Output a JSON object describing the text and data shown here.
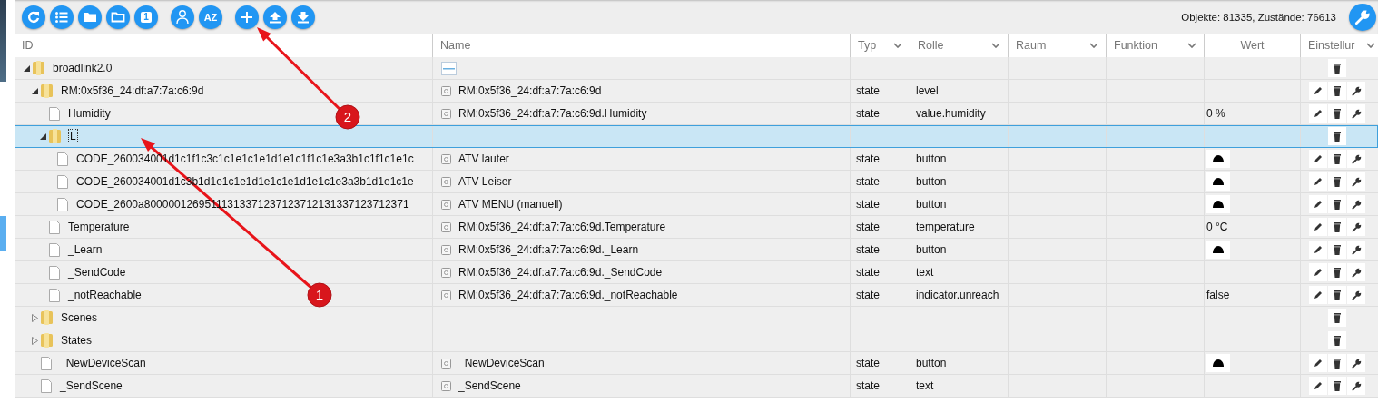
{
  "toolbar": {
    "groups": [
      [
        {
          "kind": "refresh"
        },
        {
          "kind": "list"
        },
        {
          "kind": "folder"
        },
        {
          "kind": "folder-outline"
        },
        {
          "kind": "page",
          "label": "1"
        }
      ],
      [
        {
          "kind": "user"
        },
        {
          "kind": "sort",
          "label": "AZ"
        }
      ],
      [
        {
          "kind": "add"
        },
        {
          "kind": "upload"
        },
        {
          "kind": "download"
        }
      ]
    ],
    "status": "Objekte: 81335, Zustände: 76613",
    "settings_button": {
      "kind": "wrench"
    }
  },
  "table": {
    "columns": [
      {
        "label": "ID",
        "menu": false
      },
      {
        "label": "Name",
        "menu": false
      },
      {
        "label": "Typ",
        "menu": true
      },
      {
        "label": "Rolle",
        "menu": true
      },
      {
        "label": "Raum",
        "menu": true
      },
      {
        "label": "Funktion",
        "menu": true
      },
      {
        "label": "Wert",
        "menu": false
      },
      {
        "label": "Einstellur",
        "menu": true
      }
    ],
    "rows": [
      {
        "id": "broadlink2.0",
        "kind": "folder",
        "expanded": true,
        "selected": false,
        "name_icon": {
          "kind": "logo"
        },
        "editable": false,
        "children": [
          {
            "id": "RM:0x5f36_24:df:a7:7a:c6:9d",
            "kind": "folder",
            "expanded": true,
            "selected": false,
            "name_icon": {
              "kind": "state"
            },
            "name": "RM:0x5f36_24:df:a7:7a:c6:9d",
            "typ": "state",
            "role": "level",
            "editable": true,
            "children": [
              {
                "id": "Humidity",
                "kind": "file",
                "selected": false,
                "name_icon": {
                  "kind": "state"
                },
                "name": "RM:0x5f36_24:df:a7:7a:c6:9d.Humidity",
                "typ": "state",
                "role": "value.humidity",
                "value": "0 %",
                "editable": true
              },
              {
                "id": "L",
                "kind": "folder",
                "expanded": true,
                "selected": true,
                "editable": false,
                "children": [
                  {
                    "id": "CODE_260034001d1c1f1c3c1c1e1c1e1d1e1c1f1c1e3a3b1c1f1c1e1c",
                    "kind": "file",
                    "selected": false,
                    "name_icon": {
                      "kind": "state"
                    },
                    "name": "ATV lauter",
                    "typ": "state",
                    "role": "button",
                    "value_icon": {
                      "kind": "bell"
                    },
                    "editable": true
                  },
                  {
                    "id": "CODE_260034001d1c3b1d1e1c1e1d1e1c1e1d1e1c1e3a3b1d1e1c1e",
                    "kind": "file",
                    "selected": false,
                    "name_icon": {
                      "kind": "state"
                    },
                    "name": "ATV Leiser",
                    "typ": "state",
                    "role": "button",
                    "value_icon": {
                      "kind": "bell"
                    },
                    "editable": true
                  },
                  {
                    "id": "CODE_2600a80000012695111313371237123712131337123712371",
                    "kind": "file",
                    "selected": false,
                    "name_icon": {
                      "kind": "state"
                    },
                    "name": "ATV MENU (manuell)",
                    "typ": "state",
                    "role": "button",
                    "value_icon": {
                      "kind": "bell"
                    },
                    "editable": true
                  }
                ]
              },
              {
                "id": "Temperature",
                "kind": "file",
                "selected": false,
                "name_icon": {
                  "kind": "state"
                },
                "name": "RM:0x5f36_24:df:a7:7a:c6:9d.Temperature",
                "typ": "state",
                "role": "temperature",
                "value": "0 °C",
                "editable": true
              },
              {
                "id": "_Learn",
                "kind": "file",
                "selected": false,
                "name_icon": {
                  "kind": "state"
                },
                "name": "RM:0x5f36_24:df:a7:7a:c6:9d._Learn",
                "typ": "state",
                "role": "button",
                "value_icon": {
                  "kind": "bell"
                },
                "editable": true
              },
              {
                "id": "_SendCode",
                "kind": "file",
                "selected": false,
                "name_icon": {
                  "kind": "state"
                },
                "name": "RM:0x5f36_24:df:a7:7a:c6:9d._SendCode",
                "typ": "state",
                "role": "text",
                "editable": true
              },
              {
                "id": "_notReachable",
                "kind": "file",
                "selected": false,
                "name_icon": {
                  "kind": "state"
                },
                "name": "RM:0x5f36_24:df:a7:7a:c6:9d._notReachable",
                "typ": "state",
                "role": "indicator.unreach",
                "value": "false",
                "editable": true
              }
            ]
          },
          {
            "id": "Scenes",
            "kind": "folder",
            "expanded": false,
            "selected": false,
            "editable": false
          },
          {
            "id": "States",
            "kind": "folder",
            "expanded": false,
            "selected": false,
            "editable": false
          },
          {
            "id": "_NewDeviceScan",
            "kind": "file",
            "selected": false,
            "name_icon": {
              "kind": "state"
            },
            "name": "_NewDeviceScan",
            "typ": "state",
            "role": "button",
            "value_icon": {
              "kind": "bell"
            },
            "editable": true
          },
          {
            "id": "_SendScene",
            "kind": "file",
            "selected": false,
            "name_icon": {
              "kind": "state"
            },
            "name": "_SendScene",
            "typ": "state",
            "role": "text",
            "editable": true
          }
        ]
      }
    ]
  },
  "annotations": [
    {
      "label": "1"
    },
    {
      "label": "2"
    }
  ]
}
